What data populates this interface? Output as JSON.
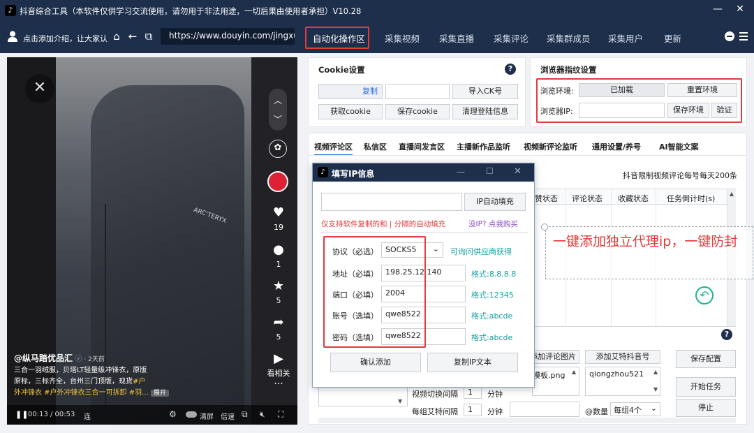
{
  "window": {
    "title": "抖音综合工具（本软件仅供学习交流使用，请勿用于非法用途，一切后果由使用者承担）V10.28",
    "min": "—",
    "close": "✕"
  },
  "nav": {
    "user_label": "点击添加介绍，让大家认",
    "url": "https://www.douyin.com/jingxuan",
    "tabs": [
      "自动化操作区",
      "采集视频",
      "采集直播",
      "采集评论",
      "采集群成员",
      "采集用户",
      "更新"
    ]
  },
  "video": {
    "likes": "19",
    "comments": "1",
    "favorites": "5",
    "shares": "5",
    "see_related": "看相关",
    "username": "@纵马踏优品汇",
    "time_ago": "· 2天前",
    "caption_line1": "三合一羽绒服，贝塔LT轻量级冲锋衣，原版",
    "caption_line2_a": "原标，三标齐全，台州三门顶版，现货",
    "caption_line2_tag": "#户",
    "caption_line3_tag": "外冲锋衣 #户外冲锋衣三合一可拆卸 #羽...",
    "expand": "展开",
    "time": "00:13 / 00:53",
    "ctl_loop": "连",
    "ctl_clear": "清屏",
    "ctl_speed": "倍速",
    "brand": "ARC'TERYX"
  },
  "cookie": {
    "title": "Cookie设置",
    "copy": "复制",
    "import": "导入CK号",
    "get": "获取cookie",
    "save": "保存cookie",
    "clear": "清理登陆信息"
  },
  "fingerprint": {
    "title": "浏览器指纹设置",
    "env_label": "浏览环境:",
    "env_status": "已加载",
    "reset": "重置环境",
    "ip_label": "浏览器IP:",
    "save_env": "保存环境",
    "verify": "验证"
  },
  "subtabs": [
    "视频评论区",
    "私信区",
    "直播间发言区",
    "主播新作品监听",
    "视频新评论监听",
    "通用设置/养号",
    "AI智能文案"
  ],
  "limit_note": "抖音限制视频评论每号每天200条",
  "table_headers": [
    "赞状态",
    "评论状态",
    "收藏状态",
    "任务倒计时(s)"
  ],
  "callout": "一键添加独立代理ip，一键防封",
  "bottom": {
    "add_comment_img": "添加评论图片",
    "add_mention": "添加艾特抖音号",
    "template_file": "模板.png",
    "mention_value": "qiongzhou521",
    "save_config": "保存配置",
    "start_task": "开始任务",
    "stop": "停止",
    "switch_interval": "视频切换间隔",
    "switch_value": "1",
    "mention_interval": "每组艾特间隔",
    "mention_value_num": "1",
    "unit_min": "分钟",
    "count_label": "@数量",
    "count_value": "每组4个"
  },
  "dialog": {
    "title": "填写IP信息",
    "auto_fill": "IP自动填充",
    "hint_red": "仅支持软件复制的和 | 分隔的自动填充",
    "hint_buy": "没IP? 点我购买",
    "protocol_label": "协议（必选）",
    "protocol_value": "SOCKS5",
    "protocol_hint": "可询问供应商获得",
    "addr_label": "地址（必填）",
    "addr_value": "198.25.12.140",
    "addr_hint": "格式:8.8.8.8",
    "port_label": "端口（必填）",
    "port_value": "2004",
    "port_hint": "格式:12345",
    "user_label": "账号（选填）",
    "user_value": "qwe8522",
    "user_hint": "格式:abcde",
    "pass_label": "密码（选填）",
    "pass_value": "qwe8522",
    "pass_hint": "格式:abcde",
    "confirm": "确认添加",
    "copy_text": "复制IP文本"
  },
  "colors": {
    "titlebar": "#1d2f4b",
    "highlight": "#e5393b",
    "teal": "#159e9e"
  }
}
